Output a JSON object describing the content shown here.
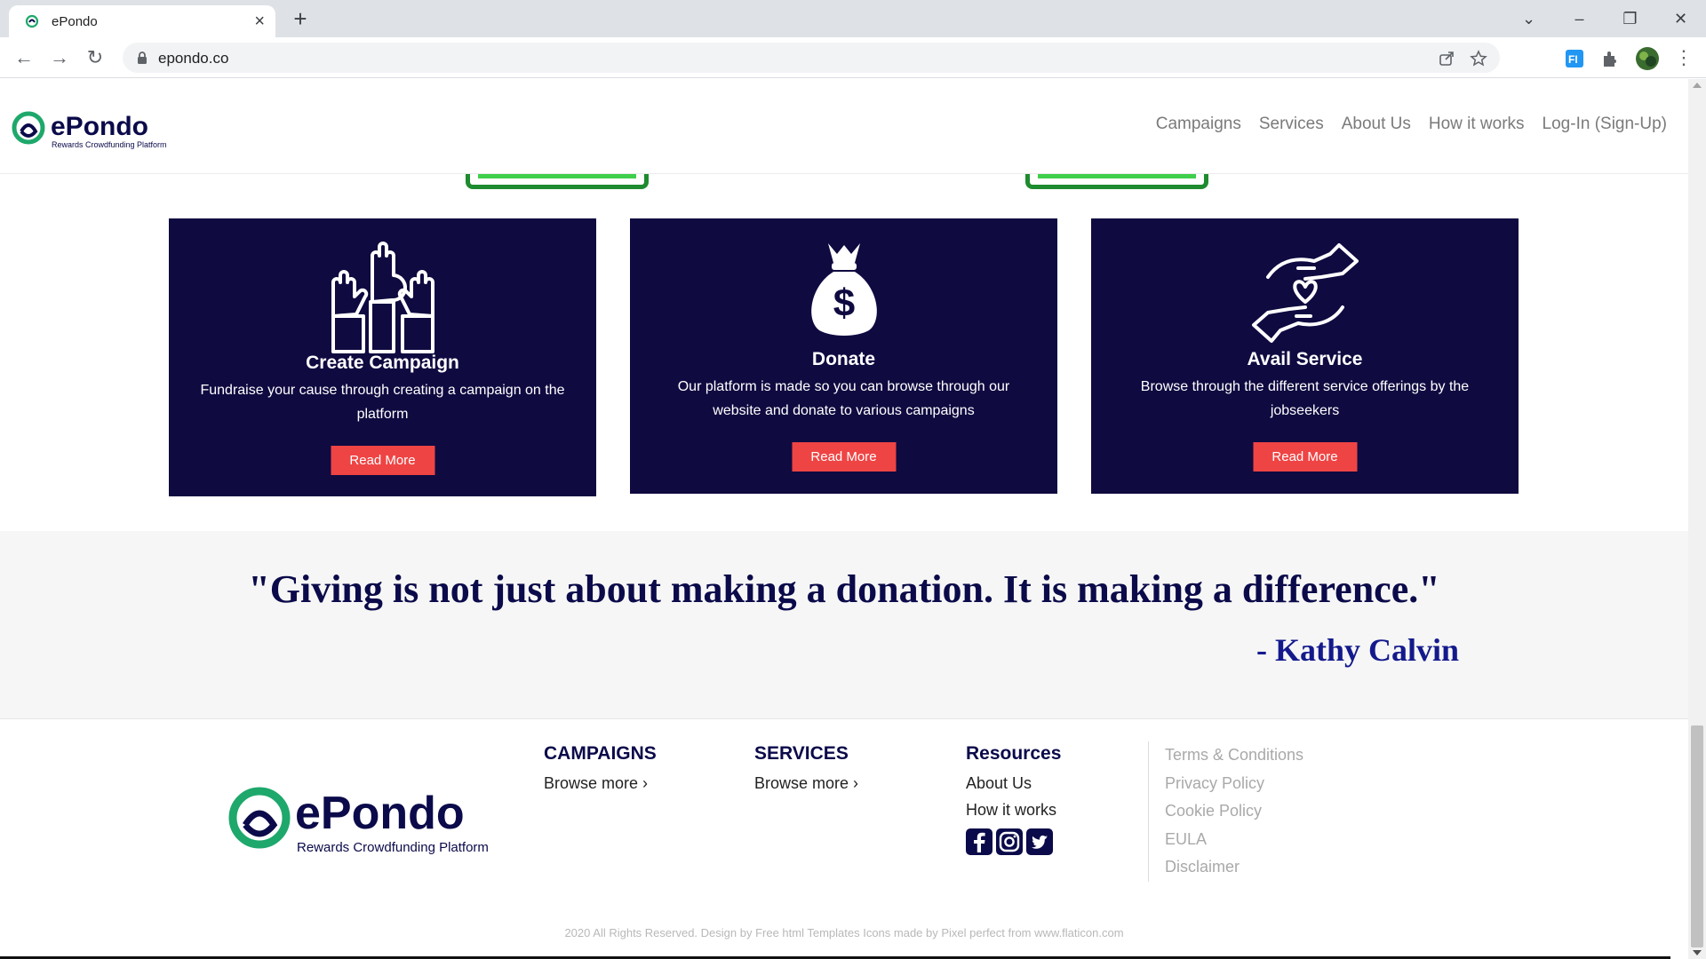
{
  "browser": {
    "tab_title": "ePondo",
    "new_tab": "+",
    "url": "epondo.co"
  },
  "site": {
    "logo_name": "ePondo",
    "logo_tagline": "Rewards Crowdfunding Platform",
    "nav": [
      "Campaigns",
      "Services",
      "About Us",
      "How it works",
      "Log-In (Sign-Up)"
    ]
  },
  "cards": [
    {
      "title": "Create Campaign",
      "text": "Fundraise your cause through creating a campaign on the platform",
      "button": "Read More",
      "icon": "raised-hands-icon"
    },
    {
      "title": "Donate",
      "text": "Our platform is made so you can browse through our website and donate to various campaigns",
      "button": "Read More",
      "icon": "money-bag-icon"
    },
    {
      "title": "Avail Service",
      "text": "Browse through the different service offerings by the jobseekers",
      "button": "Read More",
      "icon": "giving-hands-heart-icon"
    }
  ],
  "quote": {
    "text": "\"Giving is not just about making a donation. It is making a difference.\"",
    "author": "- Kathy Calvin"
  },
  "footer": {
    "campaigns": {
      "heading": "CAMPAIGNS",
      "link": "Browse more ›"
    },
    "services": {
      "heading": "SERVICES",
      "link": "Browse more ›"
    },
    "resources": {
      "heading": "Resources",
      "links": [
        "About Us",
        "How it works"
      ]
    },
    "legal": [
      "Terms & Conditions",
      "Privacy Policy",
      "Cookie Policy",
      "EULA",
      "Disclaimer"
    ],
    "copyright": "2020 All Rights Reserved. Design by Free html Templates Icons made by Pixel perfect from www.flaticon.com"
  },
  "colors": {
    "card_bg": "#0f0a40",
    "button_red": "#ef4444",
    "quote_navy": "#0b0a4a",
    "author_blue": "#141a8c"
  }
}
